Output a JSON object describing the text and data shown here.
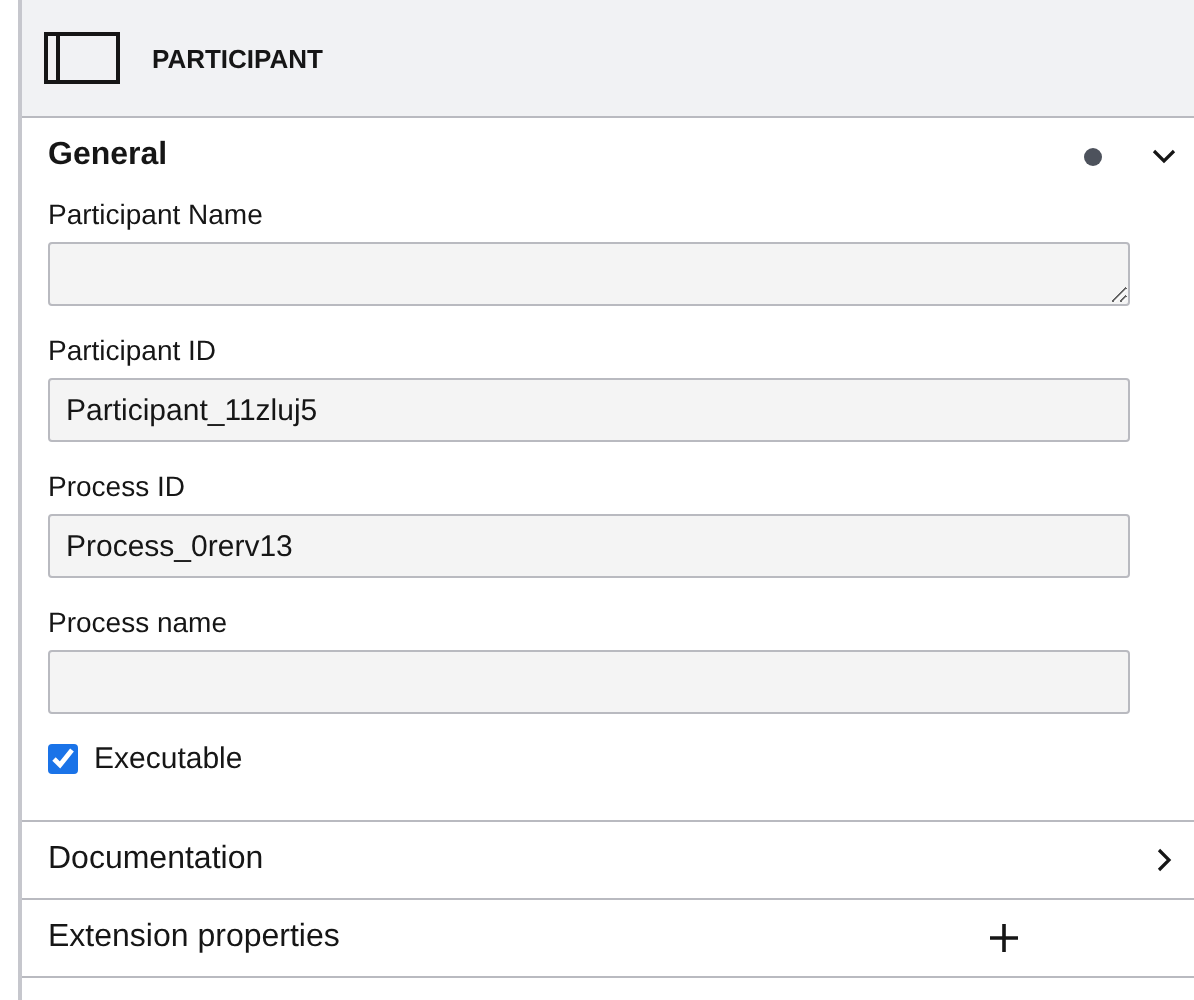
{
  "header": {
    "title": "PARTICIPANT"
  },
  "groups": [
    {
      "title": "General",
      "kind": "collapsible",
      "expanded": true,
      "edited": true,
      "fields": [
        {
          "kind": "textarea",
          "label": "Participant Name"
        },
        {
          "kind": "text",
          "label": "Participant ID",
          "value": "Participant_11zluj5"
        },
        {
          "kind": "text",
          "label": "Process ID",
          "value": "Process_0rerv13"
        },
        {
          "kind": "text",
          "label": "Process name"
        },
        {
          "kind": "checkbox",
          "label": "Executable",
          "checked": true
        }
      ]
    },
    {
      "title": "Documentation",
      "kind": "collapsible",
      "expanded": false,
      "edited": false
    },
    {
      "title": "Extension properties",
      "kind": "list",
      "edited": false
    }
  ]
}
